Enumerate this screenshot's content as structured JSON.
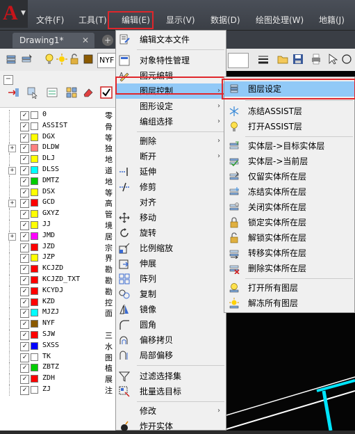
{
  "menubar": {
    "items": [
      "文件(F)",
      "工具(T)",
      "编辑(E)",
      "显示(V)",
      "数据(D)",
      "绘图处理(W)",
      "地籍(J)"
    ]
  },
  "tabs": {
    "drawing": "Drawing1*",
    "close": "✕",
    "add": "+"
  },
  "toolbar": {
    "layer_combo": "NYF"
  },
  "edit_menu": {
    "items": [
      {
        "label": "编辑文本文件",
        "icon": "edit-text-icon"
      },
      {
        "label": "对象特性管理",
        "icon": "properties-icon"
      },
      {
        "label": "图元编辑",
        "icon": "element-edit-icon"
      },
      {
        "label": "图层控制",
        "icon": "",
        "sub": "›"
      },
      {
        "label": "图形设定",
        "icon": "",
        "sub": "›"
      },
      {
        "label": "编组选择",
        "icon": "",
        "sub": "›"
      },
      {
        "label": "删除",
        "icon": "",
        "sub": "›"
      },
      {
        "label": "断开",
        "icon": "",
        "sub": "›"
      },
      {
        "label": "延伸",
        "icon": "extend-icon"
      },
      {
        "label": "修剪",
        "icon": "trim-icon"
      },
      {
        "label": "对齐",
        "icon": ""
      },
      {
        "label": "移动",
        "icon": "move-icon"
      },
      {
        "label": "旋转",
        "icon": "rotate-icon"
      },
      {
        "label": "比例缩放",
        "icon": "scale-icon"
      },
      {
        "label": "伸展",
        "icon": "stretch-icon"
      },
      {
        "label": "阵列",
        "icon": "array-icon"
      },
      {
        "label": "复制",
        "icon": "copy-icon"
      },
      {
        "label": "镜像",
        "icon": "mirror-icon"
      },
      {
        "label": "圆角",
        "icon": "fillet-icon"
      },
      {
        "label": "偏移拷贝",
        "icon": "offset-icon"
      },
      {
        "label": "局部偏移",
        "icon": "local-offset-icon"
      },
      {
        "label": "过滤选择集",
        "icon": "filter-icon"
      },
      {
        "label": "批量选目标",
        "icon": "batch-select-icon"
      },
      {
        "label": "修改",
        "icon": "",
        "sub": "›"
      },
      {
        "label": "炸开实体",
        "icon": "explode-icon"
      }
    ]
  },
  "layer_submenu": {
    "items": [
      "图层设定",
      "冻结ASSIST层",
      "打开ASSIST层",
      "实体层->目标实体层",
      "实体层->当前层",
      "仅留实体所在层",
      "冻结实体所在层",
      "关闭实体所在层",
      "锁定实体所在层",
      "解锁实体所在层",
      "转移实体所在层",
      "删除实体所在层",
      "打开所有图层",
      "解冻所有图层"
    ]
  },
  "layers": [
    {
      "name": "0",
      "color": "#ffffff",
      "desc": "零",
      "expand": false
    },
    {
      "name": "ASSIST",
      "color": "#ffffff",
      "desc": "骨",
      "expand": false
    },
    {
      "name": "DGX",
      "color": "#ffff00",
      "desc": "等",
      "expand": false
    },
    {
      "name": "DLDW",
      "color": "#ff8080",
      "desc": "独",
      "expand": true
    },
    {
      "name": "DLJ",
      "color": "#ffff00",
      "desc": "地",
      "expand": false
    },
    {
      "name": "DLSS",
      "color": "#00ffff",
      "desc": "道",
      "expand": true
    },
    {
      "name": "DMTZ",
      "color": "#00cc00",
      "desc": "地",
      "expand": false
    },
    {
      "name": "DSX",
      "color": "#ffff00",
      "desc": "等",
      "expand": false
    },
    {
      "name": "GCD",
      "color": "#ff0000",
      "desc": "高",
      "expand": true
    },
    {
      "name": "GXYZ",
      "color": "#ffff00",
      "desc": "管",
      "expand": false
    },
    {
      "name": "JJ",
      "color": "#ffff00",
      "desc": "境",
      "expand": false
    },
    {
      "name": "JMD",
      "color": "#ff00ff",
      "desc": "居",
      "expand": true
    },
    {
      "name": "JZD",
      "color": "#ff0000",
      "desc": "宗",
      "expand": false
    },
    {
      "name": "JZP",
      "color": "#ffff00",
      "desc": "界",
      "expand": false
    },
    {
      "name": "KCJZD",
      "color": "#ff0000",
      "desc": "勘",
      "expand": false
    },
    {
      "name": "KCJZD_TXT",
      "color": "#ff0000",
      "desc": "勘",
      "expand": false
    },
    {
      "name": "KCYDJ",
      "color": "#ff0000",
      "desc": "勘",
      "expand": false
    },
    {
      "name": "KZD",
      "color": "#ff0000",
      "desc": "控",
      "expand": false
    },
    {
      "name": "MJZJ",
      "color": "#00ffff",
      "desc": "面",
      "expand": false
    },
    {
      "name": "NYF",
      "color": "#8b5a00",
      "desc": "",
      "expand": false
    },
    {
      "name": "SJW",
      "color": "#ff0000",
      "desc": "三",
      "expand": false
    },
    {
      "name": "SXSS",
      "color": "#0000ff",
      "desc": "水",
      "expand": false
    },
    {
      "name": "TK",
      "color": "#ffffff",
      "desc": "图",
      "expand": false
    },
    {
      "name": "ZBTZ",
      "color": "#00cc00",
      "desc": "植",
      "expand": false
    },
    {
      "name": "ZDH",
      "color": "#ff0000",
      "desc": "展",
      "expand": false
    },
    {
      "name": "ZJ",
      "color": "#ffffff",
      "desc": "注",
      "expand": false
    }
  ],
  "colors": {
    "highlight": "#91c9f7",
    "redbox": "#e0262b"
  }
}
